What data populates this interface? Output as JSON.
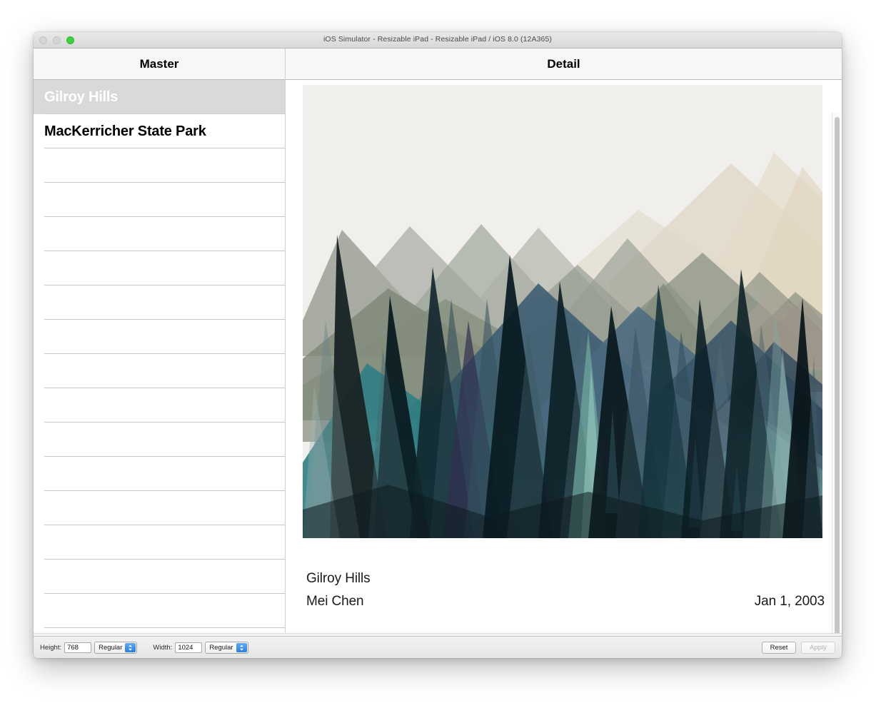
{
  "window": {
    "title": "iOS Simulator - Resizable iPad - Resizable iPad / iOS 8.0 (12A365)",
    "traffic_lights": [
      "close-button",
      "minimize-button",
      "zoom-button"
    ],
    "accent_green": "#3dd13f"
  },
  "master": {
    "nav_title": "Master",
    "rows": [
      {
        "label": "Gilroy Hills",
        "selected": true
      },
      {
        "label": "MacKerricher State Park",
        "selected": false
      },
      {
        "label": "",
        "selected": false
      },
      {
        "label": "",
        "selected": false
      },
      {
        "label": "",
        "selected": false
      },
      {
        "label": "",
        "selected": false
      },
      {
        "label": "",
        "selected": false
      },
      {
        "label": "",
        "selected": false
      },
      {
        "label": "",
        "selected": false
      },
      {
        "label": "",
        "selected": false
      },
      {
        "label": "",
        "selected": false
      },
      {
        "label": "",
        "selected": false
      },
      {
        "label": "",
        "selected": false
      },
      {
        "label": "",
        "selected": false
      },
      {
        "label": "",
        "selected": false
      },
      {
        "label": "",
        "selected": false
      }
    ]
  },
  "detail": {
    "nav_title": "Detail",
    "photo_alt": "layered-mountain-forest-illustration",
    "title": "Gilroy Hills",
    "author": "Mei Chen",
    "date": "Jan 1, 2003"
  },
  "toolbar": {
    "height_label": "Height:",
    "height_value": "768",
    "height_size_class": "Regular",
    "width_label": "Width:",
    "width_value": "1024",
    "width_size_class": "Regular",
    "reset_label": "Reset",
    "apply_label": "Apply",
    "apply_enabled": false
  },
  "artwork": {
    "sky_color": "#f1efeb",
    "palette": {
      "cream": "#e9e1d2",
      "warm_tan": "#ded3c0",
      "sage": "#8d9384",
      "olive": "#7f8672",
      "gray_green": "#9aa093",
      "steel_blue": "#5a7288",
      "deep_teal": "#2d5360",
      "teal": "#357f84",
      "navy": "#223a49",
      "dark_tree": "#10222b",
      "black_tree": "#081318",
      "pale_mint": "#9cc6bd",
      "plum": "#33304f"
    }
  }
}
